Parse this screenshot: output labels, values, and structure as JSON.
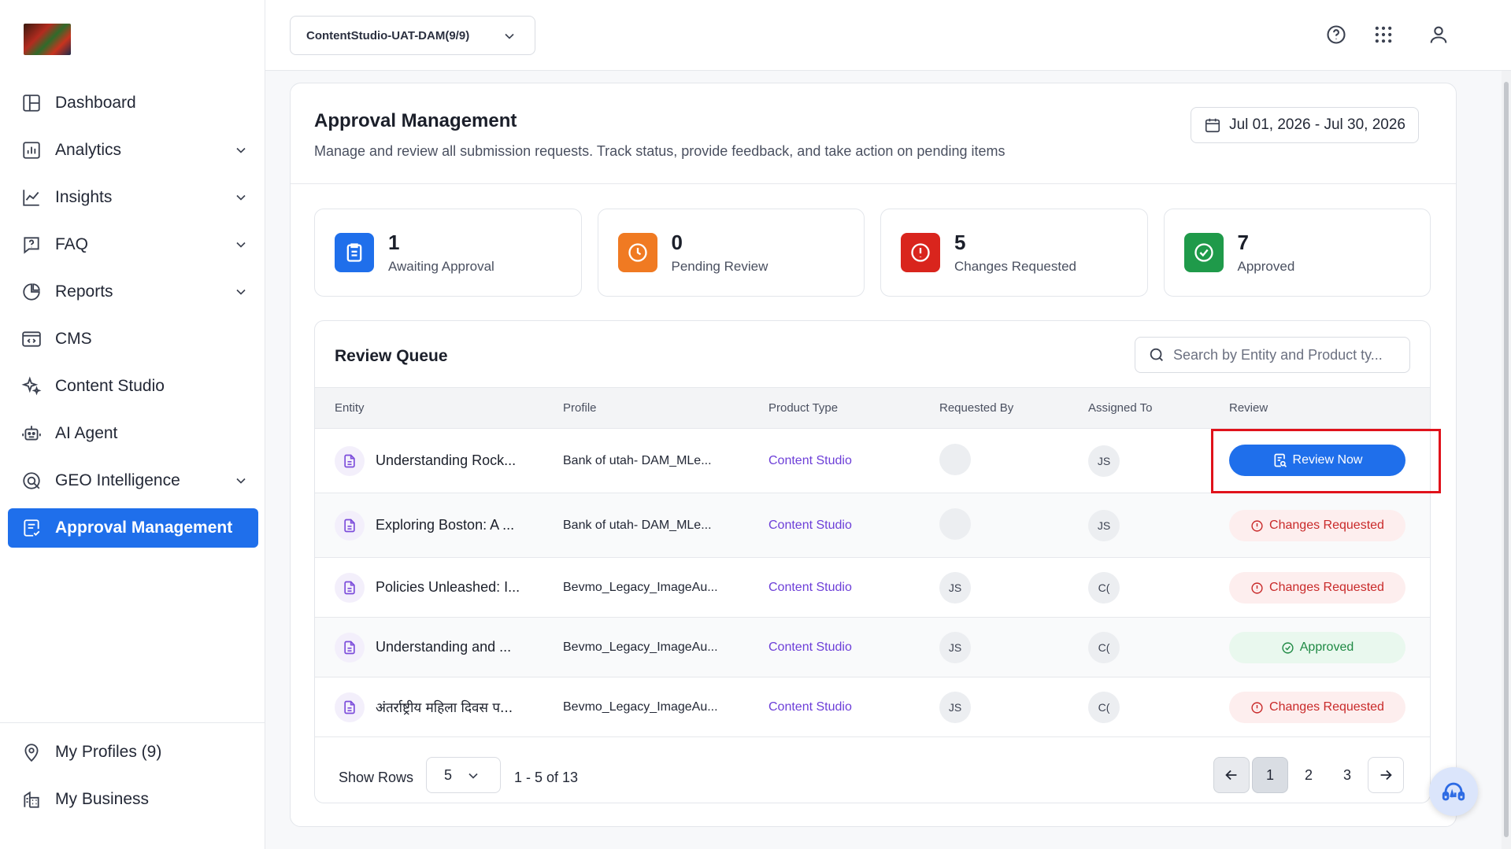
{
  "sidebar": {
    "items": [
      {
        "label": "Dashboard",
        "icon": "dashboard-icon",
        "has_chevron": false
      },
      {
        "label": "Analytics",
        "icon": "analytics-icon",
        "has_chevron": true
      },
      {
        "label": "Insights",
        "icon": "insights-icon",
        "has_chevron": true
      },
      {
        "label": "FAQ",
        "icon": "faq-icon",
        "has_chevron": true
      },
      {
        "label": "Reports",
        "icon": "reports-icon",
        "has_chevron": true
      },
      {
        "label": "CMS",
        "icon": "cms-icon",
        "has_chevron": false
      },
      {
        "label": "Content Studio",
        "icon": "sparkles-icon",
        "has_chevron": false
      },
      {
        "label": "AI Agent",
        "icon": "robot-icon",
        "has_chevron": false
      },
      {
        "label": "GEO Intelligence",
        "icon": "geo-icon",
        "has_chevron": true
      },
      {
        "label": "Approval Management",
        "icon": "approval-icon",
        "has_chevron": false,
        "active": true
      }
    ],
    "bottom_items": [
      {
        "label": "My Profiles (9)",
        "icon": "location-pin-icon"
      },
      {
        "label": "My Business",
        "icon": "building-icon"
      }
    ]
  },
  "topbar": {
    "workspace": "ContentStudio-UAT-DAM(9/9)",
    "icons": [
      "help-icon",
      "apps-grid-icon",
      "user-icon"
    ]
  },
  "page": {
    "title": "Approval Management",
    "subtitle": "Manage and review all submission requests. Track status, provide feedback, and take action on pending items",
    "date_range": "Jul 01, 2026 - Jul 30, 2026"
  },
  "stats": [
    {
      "value": "1",
      "label": "Awaiting Approval",
      "color": "#1f6feb",
      "icon": "clipboard-icon"
    },
    {
      "value": "0",
      "label": "Pending Review",
      "color": "#f07a22",
      "icon": "clock-icon"
    },
    {
      "value": "5",
      "label": "Changes Requested",
      "color": "#d9251d",
      "icon": "alert-circle-icon"
    },
    {
      "value": "7",
      "label": "Approved",
      "color": "#1f9a4a",
      "icon": "check-circle-icon"
    }
  ],
  "queue": {
    "title": "Review Queue",
    "search_placeholder": "Search by Entity and Product ty...",
    "columns": [
      "Entity",
      "Profile",
      "Product Type",
      "Requested By",
      "Assigned To",
      "Review"
    ],
    "rows": [
      {
        "entity": "Understanding Rock...",
        "profile": "Bank of utah- DAM_MLe...",
        "product": "Content Studio",
        "requested_by": "",
        "assigned_to": "JS",
        "review": "Review Now",
        "status": "action"
      },
      {
        "entity": "Exploring Boston: A ...",
        "profile": "Bank of utah- DAM_MLe...",
        "product": "Content Studio",
        "requested_by": "",
        "assigned_to": "JS",
        "review": "Changes Requested",
        "status": "changes"
      },
      {
        "entity": "Policies Unleashed: I...",
        "profile": "Bevmo_Legacy_ImageAu...",
        "product": "Content Studio",
        "requested_by": "JS",
        "assigned_to": "C(",
        "review": "Changes Requested",
        "status": "changes"
      },
      {
        "entity": "Understanding and ...",
        "profile": "Bevmo_Legacy_ImageAu...",
        "product": "Content Studio",
        "requested_by": "JS",
        "assigned_to": "C(",
        "review": "Approved",
        "status": "approved"
      },
      {
        "entity": "अंतर्राष्ट्रीय महिला दिवस प...",
        "profile": "Bevmo_Legacy_ImageAu...",
        "product": "Content Studio",
        "requested_by": "JS",
        "assigned_to": "C(",
        "review": "Changes Requested",
        "status": "changes"
      }
    ],
    "footer": {
      "show_rows_label": "Show Rows",
      "rows_value": "5",
      "range": "1 - 5 of 13",
      "pages": [
        "1",
        "2",
        "3"
      ],
      "current_page": "1"
    }
  },
  "colors": {
    "primary": "#1f6feb",
    "link": "#6d3fd8",
    "highlight": "#e0121b"
  }
}
